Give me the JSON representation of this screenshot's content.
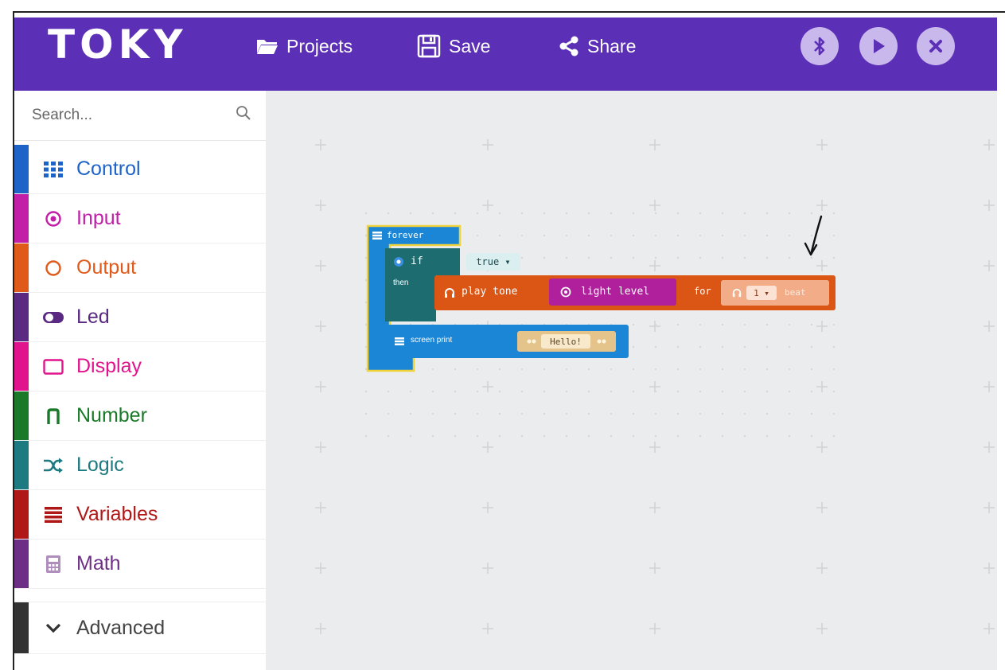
{
  "app": {
    "logo_text": "TOKY",
    "toolbar": {
      "projects_label": "Projects",
      "save_label": "Save",
      "share_label": "Share"
    },
    "colors": {
      "topbar": "#5b2fb6",
      "workspace": "#eaecee",
      "circle_buttons": "#c9b8ec"
    }
  },
  "sidebar": {
    "search_placeholder": "Search...",
    "categories": [
      {
        "label": "Control",
        "color": "#1e63c8",
        "icon": "grid-icon"
      },
      {
        "label": "Input",
        "color": "#c21ea8",
        "icon": "target-icon"
      },
      {
        "label": "Output",
        "color": "#e05a1a",
        "icon": "circle-icon"
      },
      {
        "label": "Led",
        "color": "#5a2a82",
        "icon": "toggle-icon"
      },
      {
        "label": "Display",
        "color": "#e0148c",
        "icon": "screen-icon"
      },
      {
        "label": "Number",
        "color": "#1b7a2a",
        "icon": "pi-icon"
      },
      {
        "label": "Logic",
        "color": "#1c7a80",
        "icon": "shuffle-icon"
      },
      {
        "label": "Variables",
        "color": "#b01818",
        "icon": "lines-icon"
      },
      {
        "label": "Math",
        "color": "#6d2f86",
        "icon": "calculator-icon"
      }
    ],
    "advanced_label": "Advanced",
    "advanced_color": "#333333"
  },
  "blocks": {
    "forever": "forever",
    "if": "if",
    "condition": "true ▾",
    "then": "then",
    "play_tone": "play tone",
    "light_level": "light level",
    "for": "for",
    "beat_value": "1 ▾",
    "beat": "beat",
    "screen_print": "screen print",
    "string_value": "Hello!",
    "colors": {
      "loop": "#1b86d6",
      "logic": "#1c6c70",
      "music": "#db5514",
      "input": "#b0209c",
      "beat_pill": "#f2ad88",
      "display": "#1b86d6",
      "string": "#e5c48c"
    }
  }
}
